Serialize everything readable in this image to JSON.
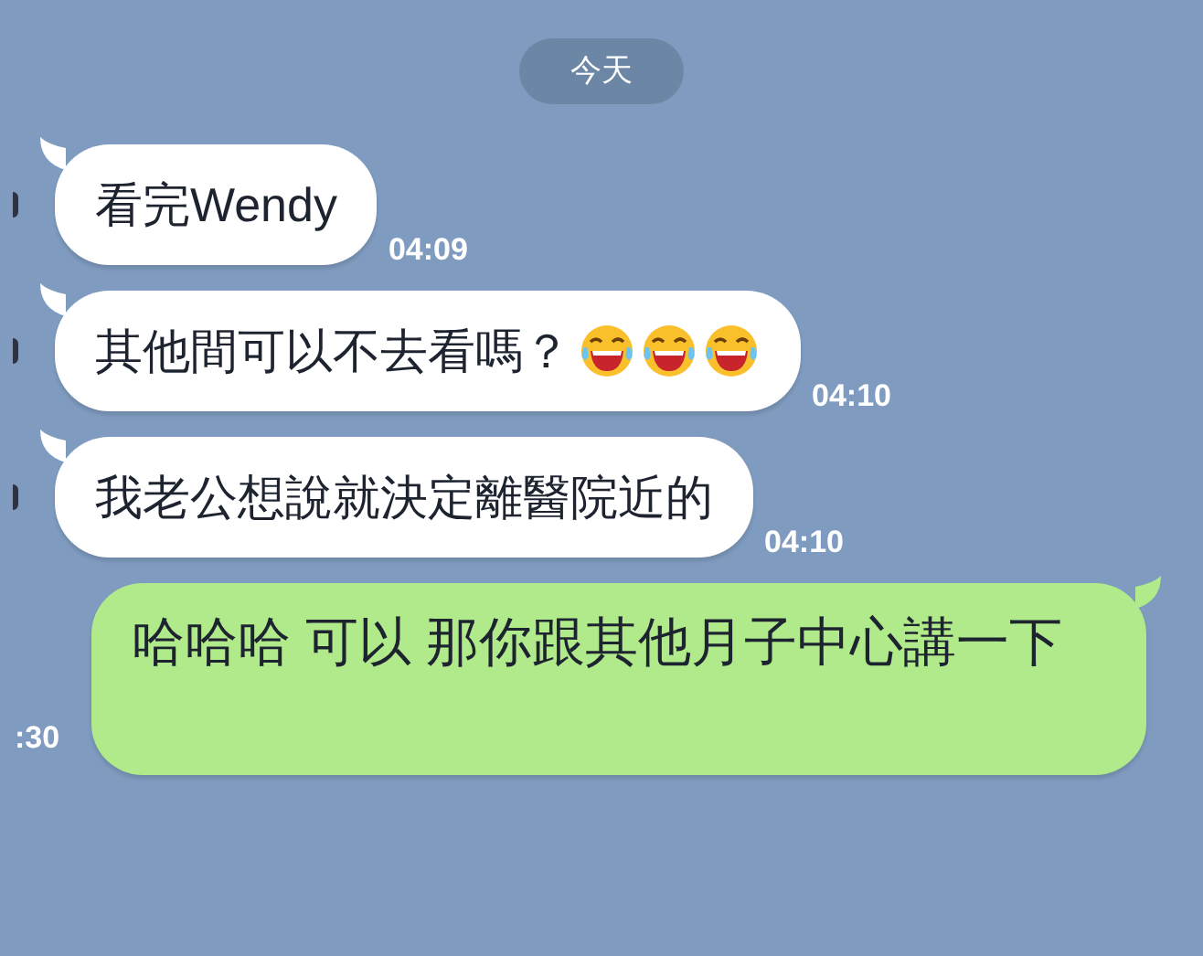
{
  "date_divider": "今天",
  "messages": [
    {
      "kind": "received",
      "text": "看完Wendy",
      "time": "04:09"
    },
    {
      "kind": "received",
      "text": "其他間可以不去看嗎？",
      "emojis": [
        {
          "kind": "tears_of_joy"
        },
        {
          "kind": "tears_of_joy"
        },
        {
          "kind": "tears_of_joy"
        }
      ],
      "time": "04:10"
    },
    {
      "kind": "received",
      "text": "我老公想說就決定離醫院近的",
      "time": "04:10"
    },
    {
      "kind": "sent",
      "text": "哈哈哈 可以 那你跟其他月子中心講一下",
      "time": ":30"
    }
  ]
}
